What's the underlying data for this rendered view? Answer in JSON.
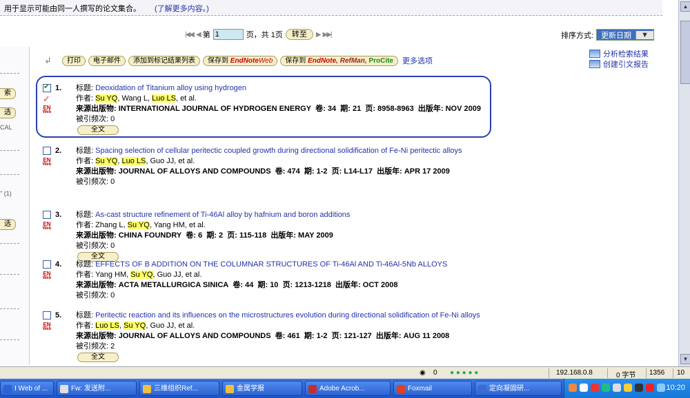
{
  "notice": {
    "text": "用于显示可能由同一人撰写的论文集合。",
    "link": "(了解更多内容。)"
  },
  "pager": {
    "first": "|◀◀",
    "prev": "◀",
    "page_label": "第",
    "page_value": "1",
    "page_suffix": "页，共 1页",
    "go": "转至",
    "next": "▶",
    "last": "▶▶|"
  },
  "sort": {
    "label": "排序方式:",
    "selected": "更新日期"
  },
  "toolbar": {
    "print": "打印",
    "email": "电子邮件",
    "add_marked": "添加到标记结果列表",
    "save_en": "保存到",
    "save_en_brand": "EndNote",
    "save_en_web": "Web",
    "save_multi": "保存到",
    "save_multi_brand1": "EndNote,",
    "save_multi_brand2": "RefMan,",
    "save_multi_brand3": "ProCite",
    "more": "更多选项"
  },
  "right_links": {
    "analyze": "分析检索结果",
    "citation_report": "创建引文报告"
  },
  "left_strip": {
    "btn1": "索",
    "btn2": "选",
    "cal": "CAL",
    "count": "\" (1)",
    "btn3": "选"
  },
  "labels": {
    "title": "标题:",
    "authors": "作者:",
    "source": "来源出版物:",
    "vol": "卷:",
    "issue": "期:",
    "pages": "页:",
    "year": "出版年:",
    "cited": "被引频次:",
    "fulltext": "全文"
  },
  "records": [
    {
      "num": "1.",
      "title": "Deoxidation of Titanium alloy using hydrogen",
      "authors_pre": "",
      "authors_hl1": "Su YQ",
      "authors_mid": ", Wang L, ",
      "authors_hl2": "Luo LS",
      "authors_post": ", et al.",
      "source": "INTERNATIONAL JOURNAL OF HYDROGEN ENERGY",
      "vol": "34",
      "issue": "21",
      "pages": "8958-8963",
      "year": "NOV 2009",
      "cited": "0",
      "checked": true
    },
    {
      "num": "2.",
      "title": "Spacing selection of cellular peritectic coupled growth during directional solidification of Fe-Ni peritectic alloys",
      "authors_pre": "",
      "authors_hl1": "Su YQ",
      "authors_mid": ", ",
      "authors_hl2": "Luo LS",
      "authors_post": ", Guo JJ, et al.",
      "source": "JOURNAL OF ALLOYS AND COMPOUNDS",
      "vol": "474",
      "issue": "1-2",
      "pages": "L14-L17",
      "year": "APR 17 2009",
      "cited": "0",
      "checked": false
    },
    {
      "num": "3.",
      "title": "As-cast structure refinement of Ti-46Al alloy by hafnium and boron additions",
      "authors_pre": "Zhang L, ",
      "authors_hl1": "Su YQ",
      "authors_mid": ", Yang HM, et al.",
      "authors_hl2": "",
      "authors_post": "",
      "source": "CHINA FOUNDRY",
      "vol": "6",
      "issue": "2",
      "pages": "115-118",
      "year": "MAY 2009",
      "cited": "0",
      "checked": false
    },
    {
      "num": "4.",
      "title": "EFFECTS OF B ADDITION ON THE COLUMNAR STRUCTURES OF Ti-46Al AND Ti-46Al-5Nb ALLOYS",
      "authors_pre": "Yang HM, ",
      "authors_hl1": "Su YQ",
      "authors_mid": ", Guo JJ, et al.",
      "authors_hl2": "",
      "authors_post": "",
      "source": "ACTA METALLURGICA SINICA",
      "vol": "44",
      "issue": "10",
      "pages": "1213-1218",
      "year": "OCT 2008",
      "cited": "0",
      "checked": false
    },
    {
      "num": "5.",
      "title": "Peritectic reaction and its influences on the microstructures evolution during directional solidification of Fe-Ni alloys",
      "authors_pre": "",
      "authors_hl1": "Luo LS",
      "authors_mid": ", ",
      "authors_hl2": "Su YQ",
      "authors_post": ", Guo JJ, et al.",
      "source": "JOURNAL OF ALLOYS AND COMPOUNDS",
      "vol": "461",
      "issue": "1-2",
      "pages": "121-127",
      "year": "AUG 11 2008",
      "cited": "2",
      "checked": false
    }
  ],
  "status": {
    "icons_count": "0",
    "ip": "192.168.0.8",
    "bytes": "0 字节",
    "size": "1356",
    "num": "10"
  },
  "taskbar": {
    "tasks": [
      {
        "label": "I Web of ...",
        "color": "#2d63d0"
      },
      {
        "label": "Fw: 发送附...",
        "color": "#e0e0e0"
      },
      {
        "label": "三维组织Ref...",
        "color": "#f0c040"
      },
      {
        "label": "金属学报",
        "color": "#f0c040"
      },
      {
        "label": "Adobe Acrob...",
        "color": "#c03030"
      },
      {
        "label": "Foxmail",
        "color": "#e04020"
      },
      {
        "label": "定向凝固研...",
        "color": "#3a6bd0"
      }
    ],
    "clock": "10:20"
  }
}
